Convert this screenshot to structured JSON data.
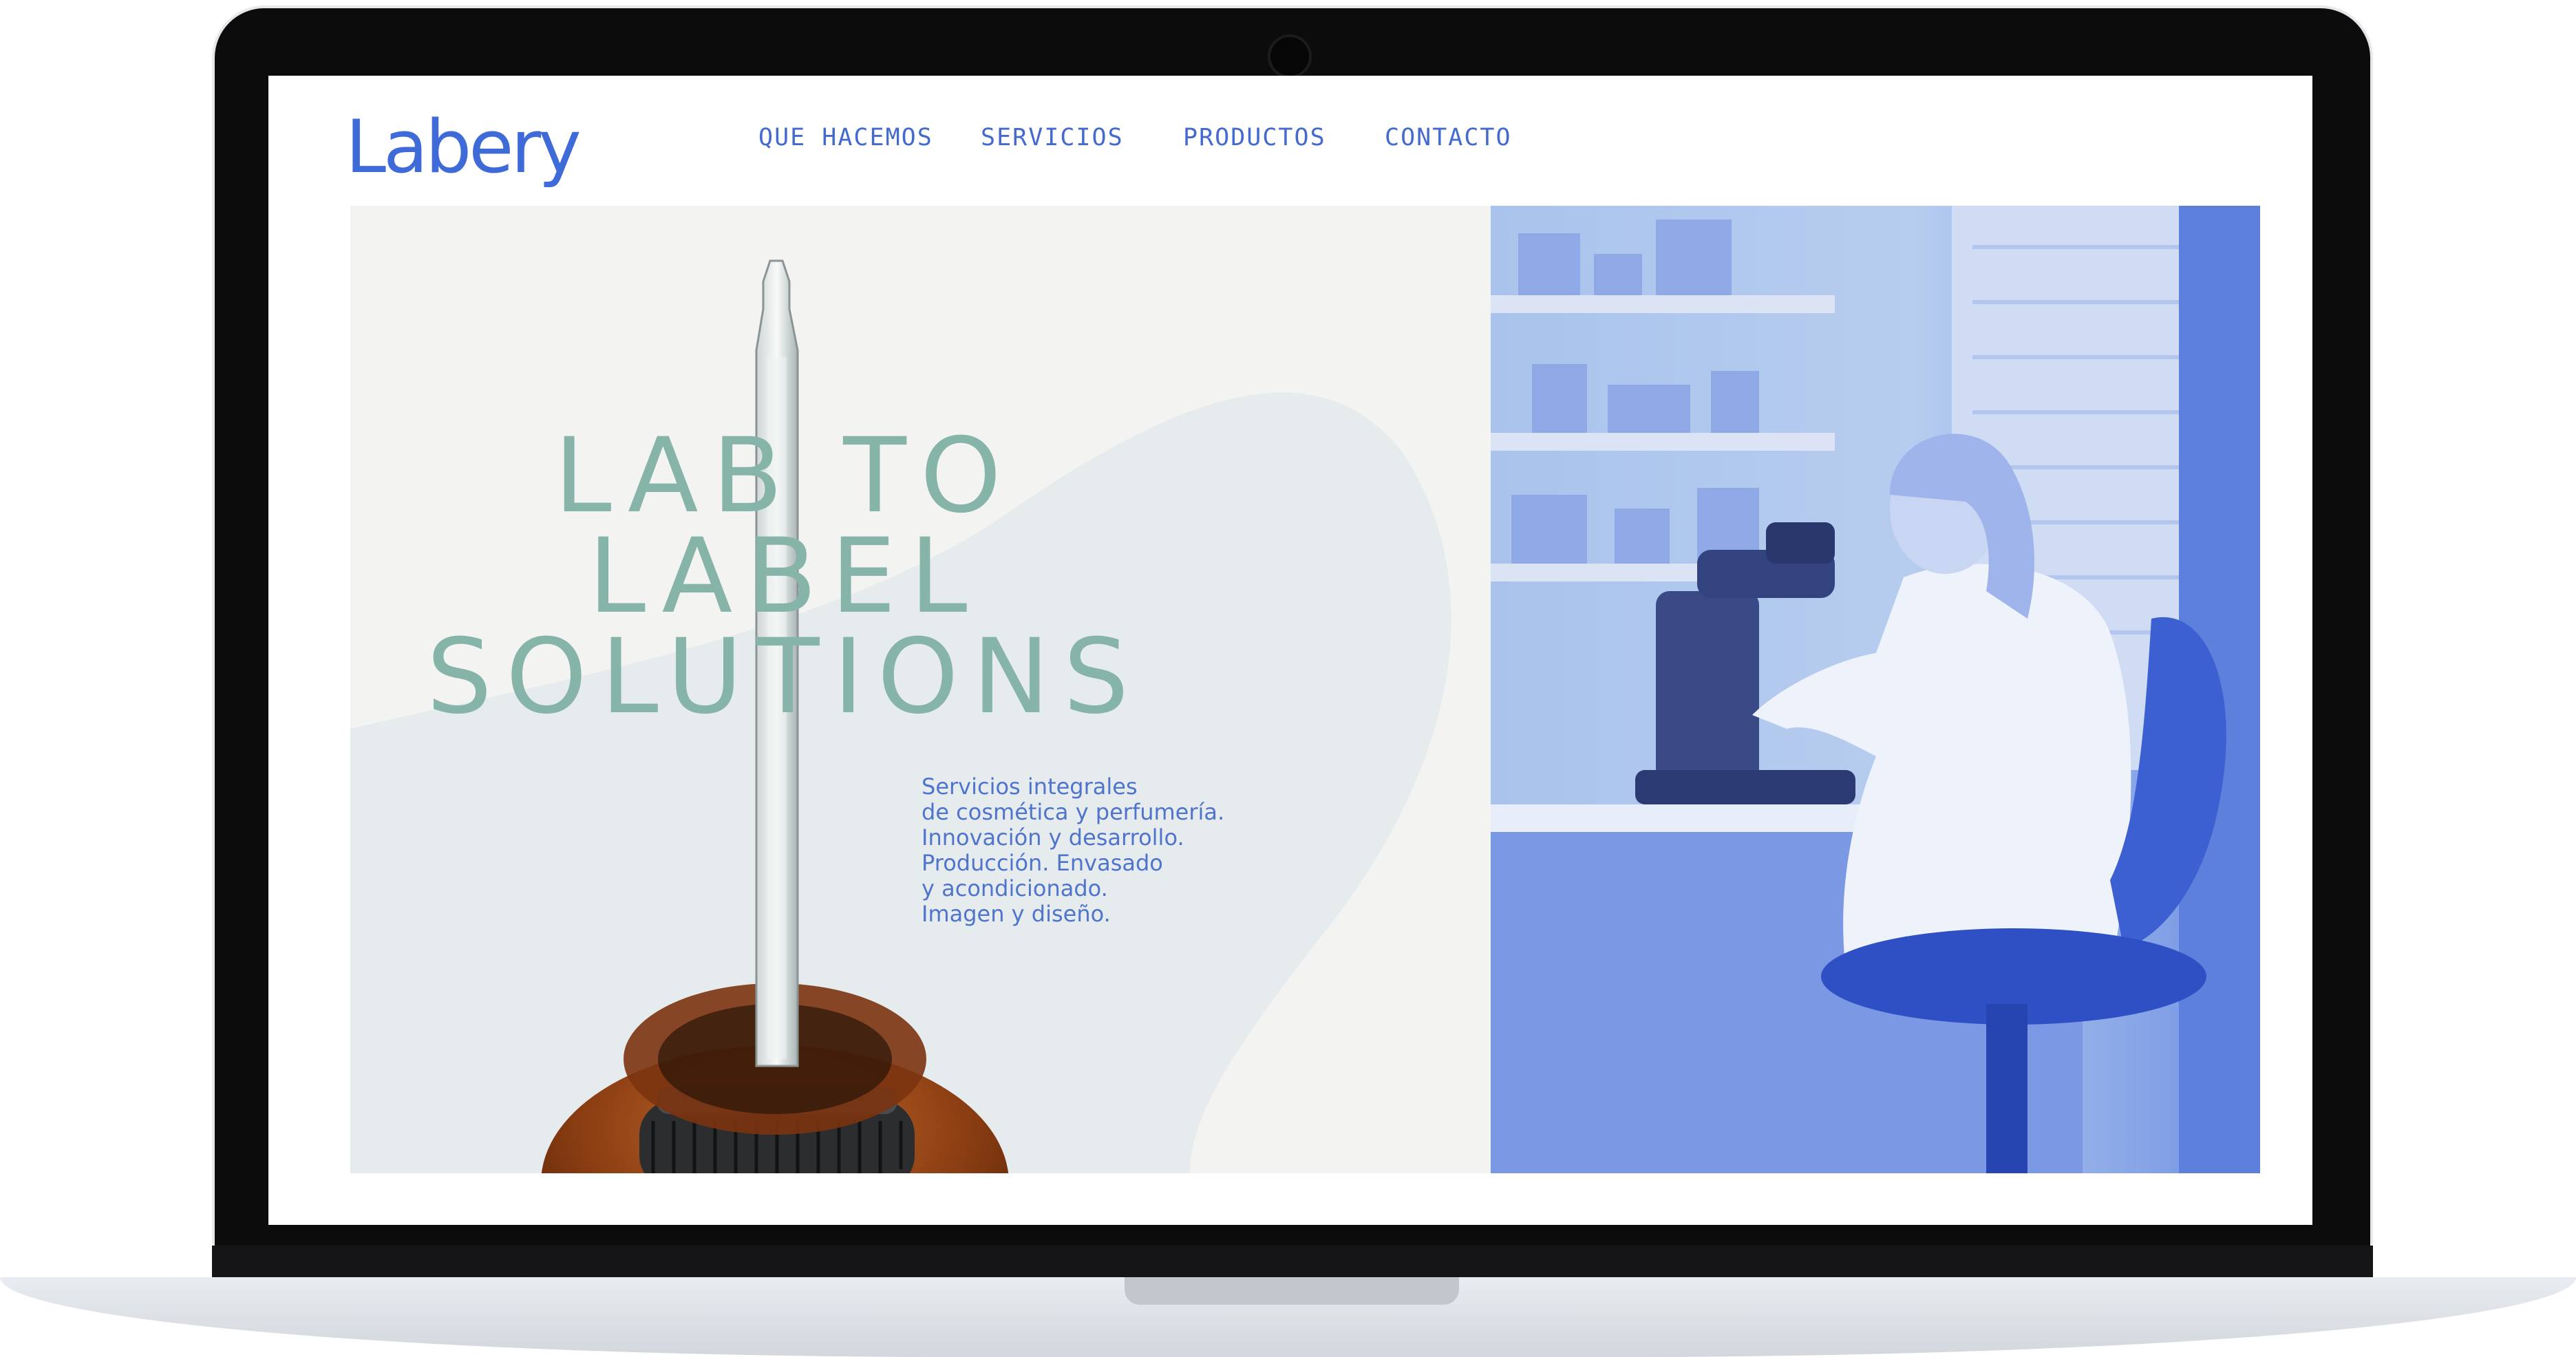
{
  "site": {
    "logo": "Labery"
  },
  "nav": {
    "items": [
      {
        "label": "QUE HACEMOS"
      },
      {
        "label": "SERVICIOS"
      },
      {
        "label": "PRODUCTOS"
      },
      {
        "label": "CONTACTO"
      }
    ]
  },
  "hero": {
    "headline": [
      "LAB TO",
      "LABEL",
      "SOLUTIONS"
    ],
    "description": [
      "Servicios integrales",
      "de cosmética y perfumería.",
      "Innovación y desarrollo.",
      "Producción. Envasado",
      "y acondicionado.",
      "Imagen y diseño."
    ]
  },
  "colors": {
    "brand_blue": "#3f6bd8",
    "headline_green": "#86b4a9",
    "photo_tint": "#6e8fe2"
  }
}
